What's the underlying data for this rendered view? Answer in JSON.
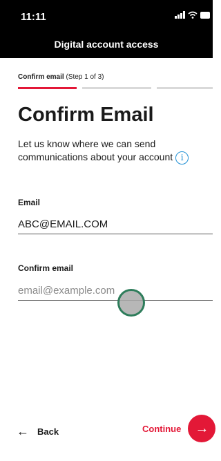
{
  "status_bar": {
    "time": "11:11"
  },
  "header": {
    "title": "Digital account access"
  },
  "step": {
    "name": "Confirm email",
    "detail": "(Step 1 of 3)",
    "current": 1,
    "total": 3
  },
  "page": {
    "title": "Confirm Email",
    "subtitle": "Let us know where we can send communications about your account",
    "info_icon_glyph": "i"
  },
  "form": {
    "email_label": "Email",
    "email_value": "ABC@EMAIL.COM",
    "confirm_label": "Confirm email",
    "confirm_placeholder": "email@example.com"
  },
  "footer": {
    "back_icon": "←",
    "back_label": "Back",
    "continue_label": "Continue",
    "continue_icon": "→"
  },
  "colors": {
    "accent": "#e31837",
    "info": "#1f8fd4",
    "header_bg": "#000000"
  }
}
